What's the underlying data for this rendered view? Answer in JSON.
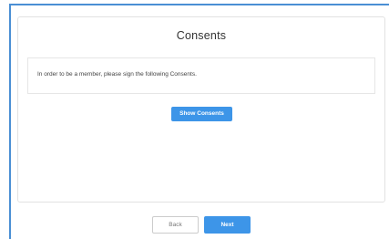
{
  "card": {
    "title": "Consents",
    "message": "In order to be a member, please sign the following Consents.",
    "show_consents_label": "Show Consents"
  },
  "footer": {
    "back_label": "Back",
    "next_label": "Next"
  },
  "colors": {
    "accent": "#3d95e8",
    "frame_border": "#4a8fd4"
  }
}
